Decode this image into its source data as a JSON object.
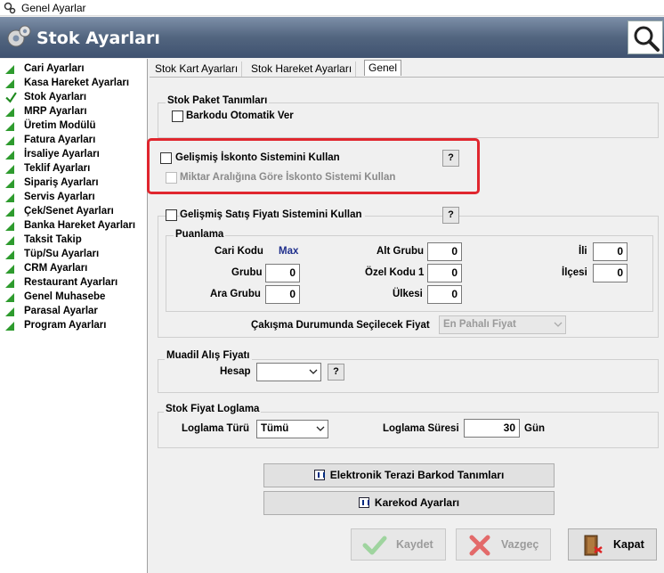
{
  "window": {
    "title": "Genel Ayarlar"
  },
  "header": {
    "title": "Stok Ayarları",
    "search_icon": "magnifier-icon",
    "gear_icon": "gears-icon"
  },
  "sidebar": {
    "items": [
      {
        "label": "Cari Ayarları",
        "icon": "green-triangle-icon"
      },
      {
        "label": "Kasa Hareket Ayarları",
        "icon": "green-triangle-icon"
      },
      {
        "label": "Stok Ayarları",
        "icon": "checkmark-icon"
      },
      {
        "label": "MRP Ayarları",
        "icon": "green-triangle-icon"
      },
      {
        "label": "Üretim Modülü",
        "icon": "green-triangle-icon"
      },
      {
        "label": "Fatura Ayarları",
        "icon": "green-triangle-icon"
      },
      {
        "label": "İrsaliye Ayarları",
        "icon": "green-triangle-icon"
      },
      {
        "label": "Teklif Ayarları",
        "icon": "green-triangle-icon"
      },
      {
        "label": "Sipariş Ayarları",
        "icon": "green-triangle-icon"
      },
      {
        "label": "Servis Ayarları",
        "icon": "green-triangle-icon"
      },
      {
        "label": "Çek/Senet Ayarları",
        "icon": "green-triangle-icon"
      },
      {
        "label": "Banka Hareket Ayarları",
        "icon": "green-triangle-icon"
      },
      {
        "label": "Taksit Takip",
        "icon": "green-triangle-icon"
      },
      {
        "label": "Tüp/Su Ayarları",
        "icon": "green-triangle-icon"
      },
      {
        "label": "CRM Ayarları",
        "icon": "green-triangle-icon"
      },
      {
        "label": "Restaurant Ayarları",
        "icon": "green-triangle-icon"
      },
      {
        "label": "Genel Muhasebe",
        "icon": "green-triangle-icon"
      },
      {
        "label": "Parasal Ayarlar",
        "icon": "green-triangle-icon"
      },
      {
        "label": "Program Ayarları",
        "icon": "green-triangle-icon"
      }
    ]
  },
  "tabs": [
    {
      "label": "Stok Kart Ayarları"
    },
    {
      "label": "Stok Hareket Ayarları"
    },
    {
      "label": "Genel",
      "active": true
    }
  ],
  "stok_paket": {
    "title": "Stok Paket Tanımları",
    "barkod_label": "Barkodu Otomatik Ver"
  },
  "iskonto": {
    "gelismis_label": "Gelişmiş İskonto Sistemini Kullan",
    "miktar_label": "Miktar Aralığına Göre İskonto Sistemi Kullan",
    "help": "?"
  },
  "satis_fiyati": {
    "label": "Gelişmiş Satış Fiyatı Sistemini Kullan",
    "help": "?",
    "puanlama_title": "Puanlama",
    "cari_kodu_label": "Cari Kodu",
    "cari_kodu_value": "Max",
    "grubu_label": "Grubu",
    "grubu_value": "0",
    "ara_grubu_label": "Ara Grubu",
    "ara_grubu_value": "0",
    "alt_grubu_label": "Alt Grubu",
    "alt_grubu_value": "0",
    "ozel_kodu_label": "Özel Kodu 1",
    "ozel_kodu_value": "0",
    "ulkesi_label": "Ülkesi",
    "ulkesi_value": "0",
    "ili_label": "İli",
    "ili_value": "0",
    "ilcesi_label": "İlçesi",
    "ilcesi_value": "0",
    "cakisma_label": "Çakışma Durumunda Seçilecek Fiyat",
    "cakisma_value": "En Pahalı Fiyat"
  },
  "muadil": {
    "title": "Muadil Alış Fiyatı",
    "hesap_label": "Hesap",
    "hesap_value": "",
    "help": "?"
  },
  "loglama": {
    "title": "Stok Fiyat Loglama",
    "turu_label": "Loglama Türü",
    "turu_value": "Tümü",
    "suresi_label": "Loglama Süresi",
    "suresi_value": "30",
    "gun_label": "Gün"
  },
  "buttons": {
    "terazi": "Elektronik Terazi Barkod Tanımları",
    "karekod": "Karekod Ayarları",
    "kaydet": "Kaydet",
    "vazgec": "Vazgeç",
    "kapat": "Kapat"
  },
  "colors": {
    "header_bg": "#52657f",
    "highlight": "#e0262e",
    "sidebar_icon": "#2e9b2e"
  }
}
